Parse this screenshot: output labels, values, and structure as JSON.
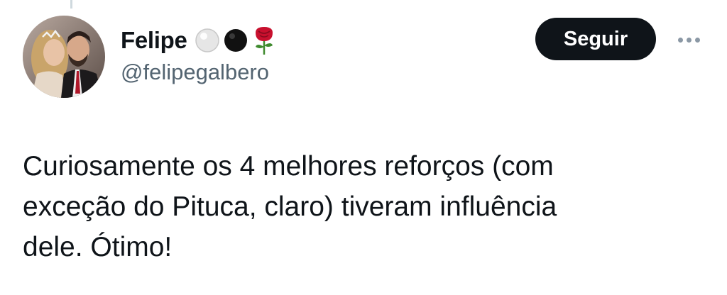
{
  "author": {
    "display_name": "Felipe",
    "handle": "@felipegalbero",
    "name_emojis": [
      "white-circle-icon",
      "black-circle-icon",
      "rose-icon"
    ],
    "avatar": "couple-photo-avatar"
  },
  "actions": {
    "follow_label": "Seguir",
    "more_icon": "more-horizontal-icon"
  },
  "tweet": {
    "text": "Curiosamente os 4 melhores reforços (com\nexceção do Pituca, claro) tiveram influência\ndele. Ótimo!"
  },
  "colors": {
    "text_primary": "#0f1419",
    "text_secondary": "#536471",
    "button_bg": "#0f1419",
    "button_text": "#ffffff"
  }
}
